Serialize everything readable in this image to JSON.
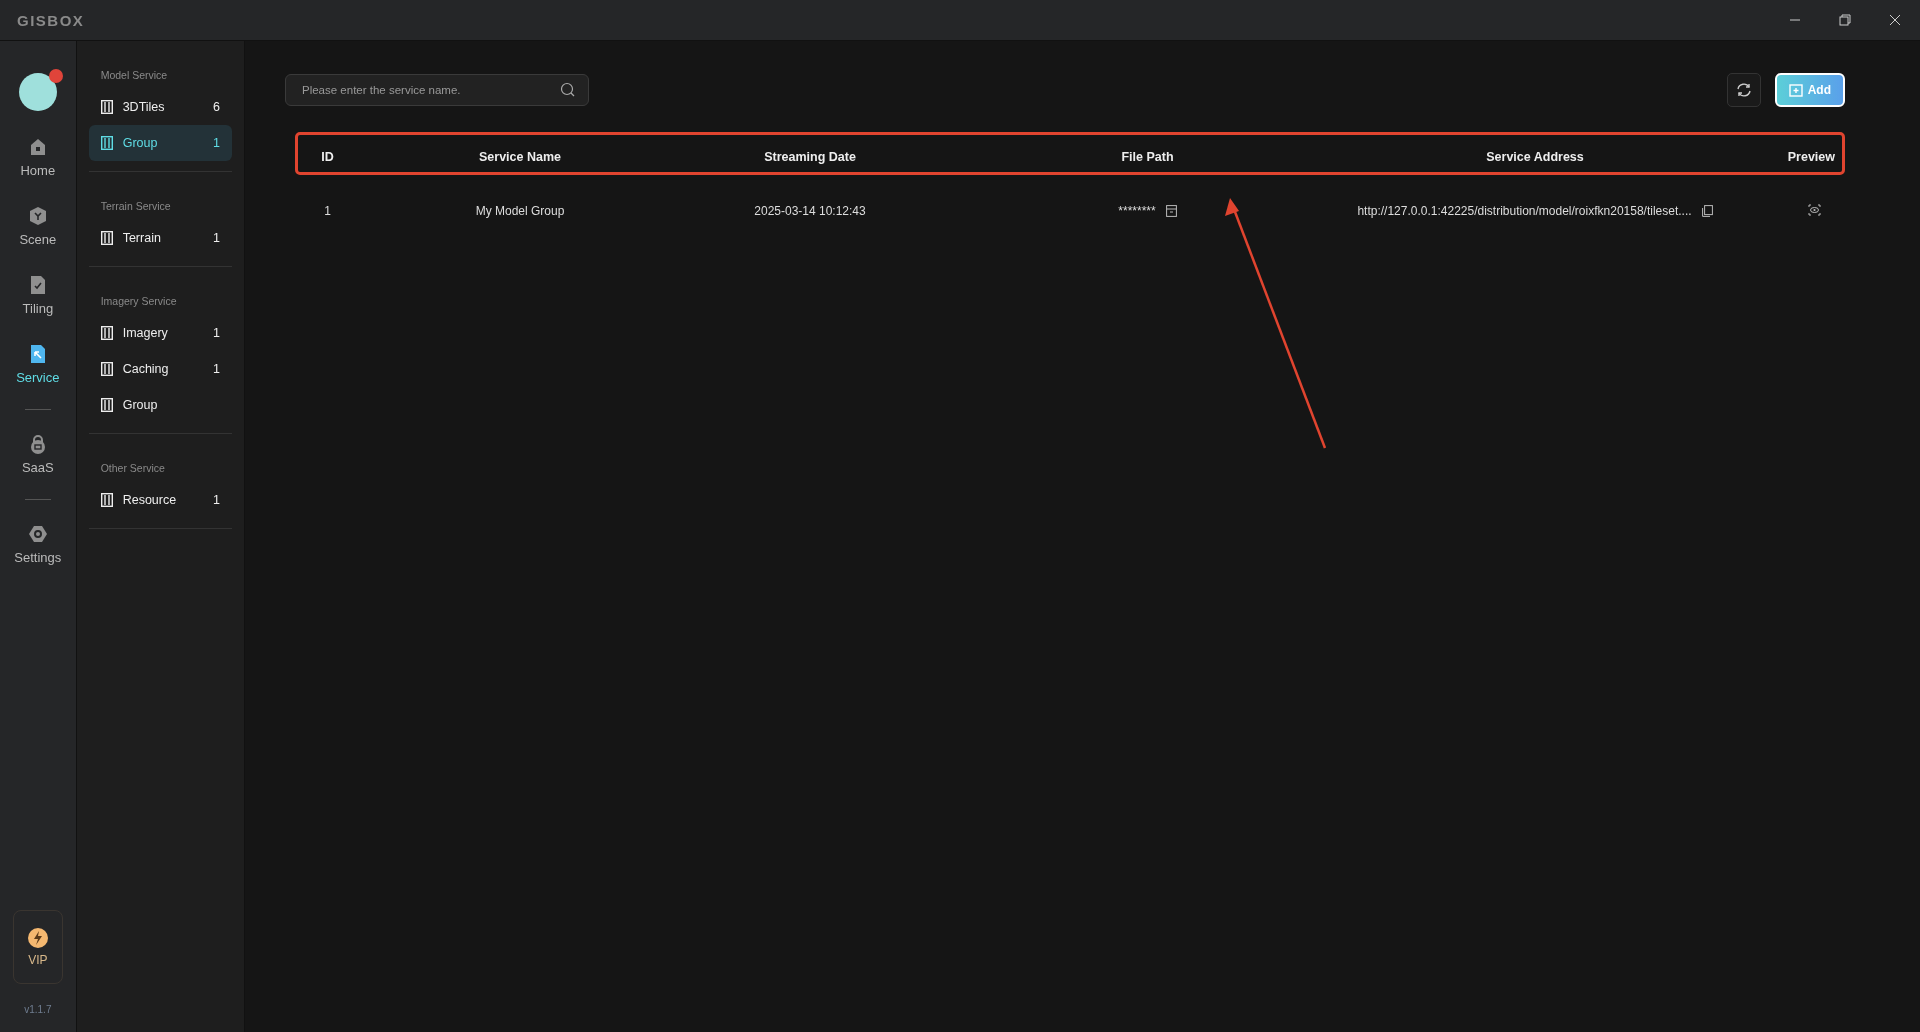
{
  "window": {
    "title": "GISBOX"
  },
  "rail": {
    "groups": [
      [
        {
          "label": "Home",
          "selected": false
        },
        {
          "label": "Scene",
          "selected": false
        },
        {
          "label": "Tiling",
          "selected": false
        },
        {
          "label": "Service",
          "selected": true
        }
      ],
      [
        {
          "label": "SaaS",
          "selected": false
        }
      ],
      [
        {
          "label": "Settings",
          "selected": false
        }
      ]
    ],
    "vip": "VIP",
    "version": "v1.1.7"
  },
  "sidebar": {
    "sections": [
      {
        "title": "Model Service",
        "items": [
          {
            "label": "3DTiles",
            "count": "6",
            "selected": false
          },
          {
            "label": "Group",
            "count": "1",
            "selected": true
          }
        ]
      },
      {
        "title": "Terrain Service",
        "items": [
          {
            "label": "Terrain",
            "count": "1",
            "selected": false
          }
        ]
      },
      {
        "title": "Imagery Service",
        "items": [
          {
            "label": "Imagery",
            "count": "1",
            "selected": false
          },
          {
            "label": "Caching",
            "count": "1",
            "selected": false
          },
          {
            "label": "Group",
            "selected": false
          }
        ]
      },
      {
        "title": "Other Service",
        "items": [
          {
            "label": "Resource",
            "count": "1",
            "selected": false
          }
        ]
      }
    ]
  },
  "search": {
    "placeholder": "Please enter the service name."
  },
  "add_button": "Add",
  "table": {
    "columns": [
      "ID",
      "Service Name",
      "Streaming Date",
      "File Path",
      "Service Address",
      "Preview"
    ],
    "rows": [
      {
        "id": "1",
        "name": "My Model Group",
        "date": "2025-03-14 10:12:43",
        "file_path": "********",
        "address": "http://127.0.0.1:42225/distribution/model/roixfkn20158/tileset...."
      }
    ]
  }
}
